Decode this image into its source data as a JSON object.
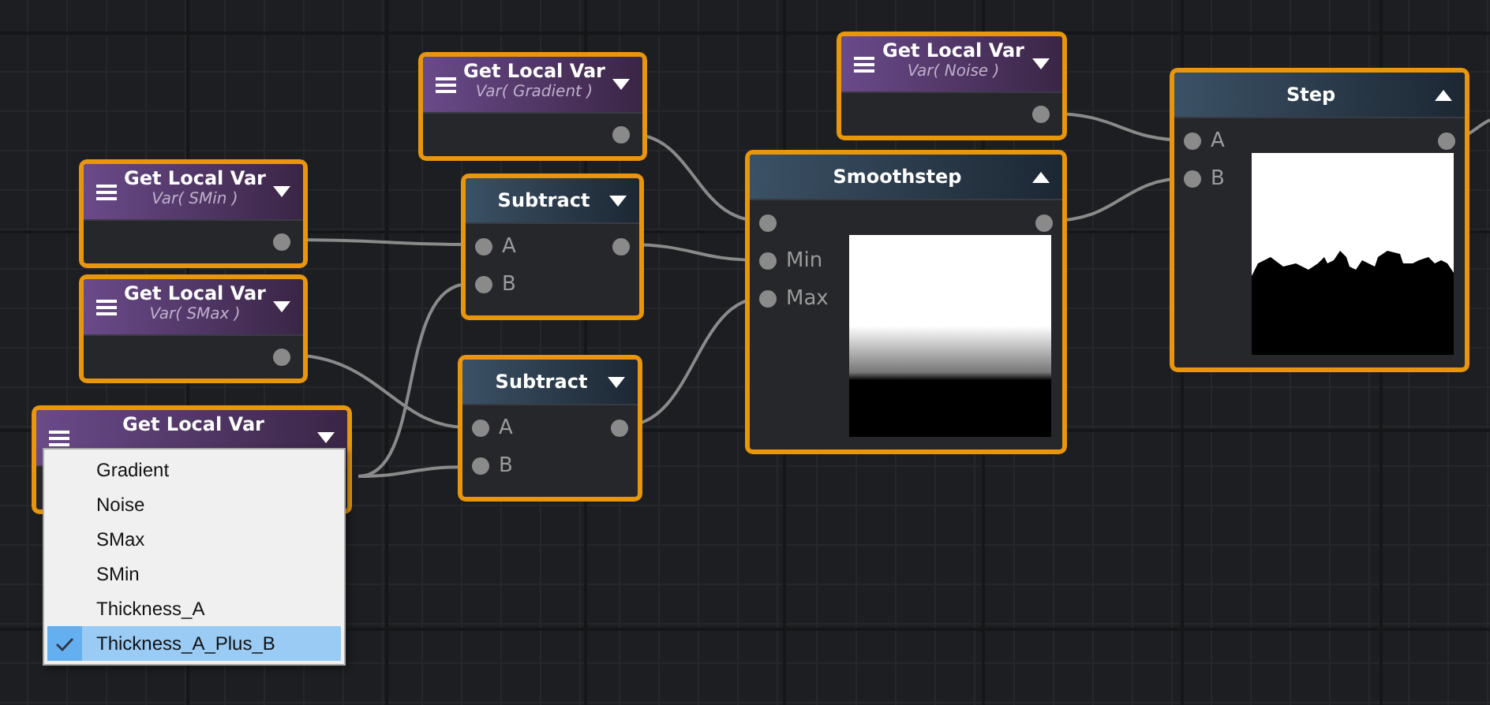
{
  "nodes": [
    {
      "kind": "get_var",
      "title": "Get Local Var",
      "subtitle": "Var( Gradient )",
      "expanded": false,
      "output": true
    },
    {
      "kind": "get_var",
      "title": "Get Local Var",
      "subtitle": "Var( SMin )",
      "expanded": false,
      "output": true
    },
    {
      "kind": "get_var",
      "title": "Get Local Var",
      "subtitle": "Var( SMax )",
      "expanded": false,
      "output": true
    },
    {
      "kind": "get_var",
      "title": "Get Local Var",
      "expanded": false
    },
    {
      "kind": "op",
      "title": "Subtract",
      "expanded": false,
      "inputs": [
        {
          "label": "A"
        },
        {
          "label": "B"
        }
      ]
    },
    {
      "kind": "op",
      "title": "Subtract",
      "expanded": false,
      "inputs": [
        {
          "label": "A"
        },
        {
          "label": "B"
        }
      ]
    },
    {
      "kind": "get_var",
      "title": "Get Local Var",
      "subtitle": "Var( Noise )",
      "expanded": false,
      "output": true
    },
    {
      "kind": "op",
      "title": "Smoothstep",
      "expanded": true,
      "inputs": [
        {
          "kind": "unlabeled"
        },
        {
          "kind": "labeled",
          "label": "Min"
        },
        {
          "kind": "labeled",
          "label": "Max"
        }
      ],
      "preview": {
        "kind": "picture"
      }
    },
    {
      "kind": "op",
      "title": "Step",
      "expanded": true,
      "inputs": [
        {
          "label": "A"
        },
        {
          "label": "B"
        }
      ],
      "preview": {
        "kind": "picture"
      }
    }
  ],
  "menu": {
    "items": [
      {
        "label": "Gradient",
        "selected": false
      },
      {
        "label": "Noise",
        "selected": false
      },
      {
        "label": "SMax",
        "selected": false
      },
      {
        "label": "SMin",
        "selected": false
      },
      {
        "label": "Thickness_A",
        "selected": false
      },
      {
        "label": "Thickness_A_Plus_B",
        "selected": true
      }
    ]
  }
}
